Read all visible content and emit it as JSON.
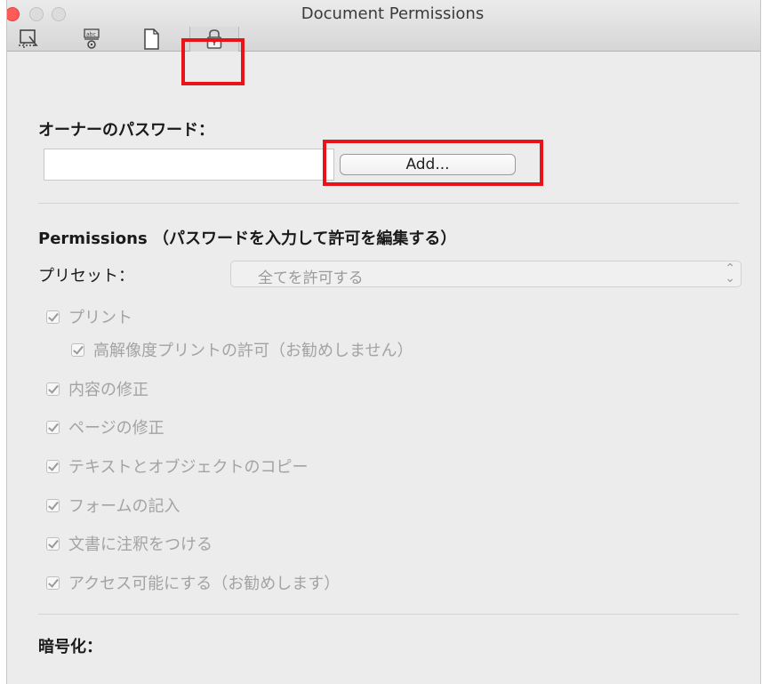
{
  "window": {
    "title": "Document Permissions"
  },
  "toolbar": {
    "items": [
      {
        "icon": "crop-box-icon"
      },
      {
        "icon": "ocr-text-icon"
      },
      {
        "icon": "document-icon"
      },
      {
        "icon": "lock-icon",
        "selected": true
      }
    ]
  },
  "owner_password": {
    "heading": "オーナーのパスワード：",
    "input_value": "",
    "add_button": "Add..."
  },
  "permissions": {
    "heading": "Permissions （パスワードを入力して許可を編集する）",
    "preset_label": "プリセット：",
    "preset_value": "全てを許可する",
    "items": [
      {
        "label": "プリント",
        "checked": true,
        "enabled": false
      },
      {
        "label": "高解像度プリントの許可（お勧めしません）",
        "checked": true,
        "enabled": false
      },
      {
        "label": "内容の修正",
        "checked": true,
        "enabled": false
      },
      {
        "label": "ページの修正",
        "checked": true,
        "enabled": false
      },
      {
        "label": "テキストとオブジェクトのコピー",
        "checked": true,
        "enabled": false
      },
      {
        "label": "フォームの記入",
        "checked": true,
        "enabled": false
      },
      {
        "label": "文書に注釈をつける",
        "checked": true,
        "enabled": false
      },
      {
        "label": "アクセス可能にする（お勧めします）",
        "checked": true,
        "enabled": false
      }
    ]
  },
  "encryption": {
    "heading": "暗号化："
  },
  "colors": {
    "highlight": "#e8141a",
    "close_button": "#fc5b57",
    "disabled_text": "#a3a3a3"
  }
}
